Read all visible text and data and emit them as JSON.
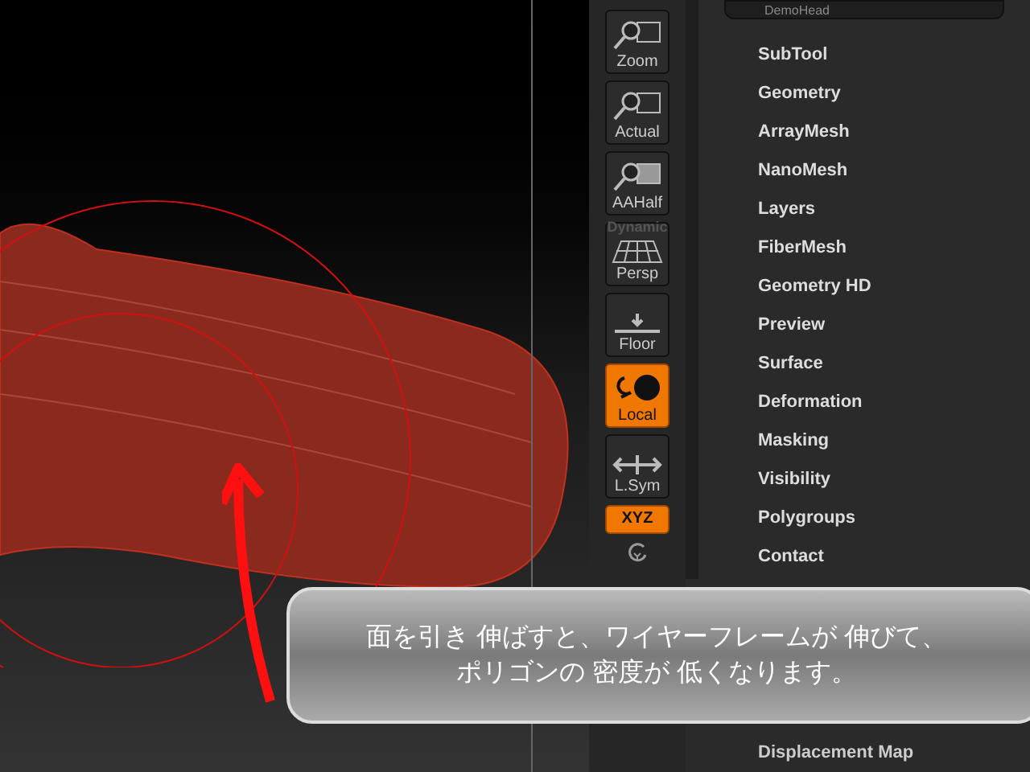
{
  "subtool_preview": {
    "label": "DemoHead"
  },
  "shelf": [
    {
      "kind": "button",
      "label": "Zoom",
      "on": false
    },
    {
      "kind": "button",
      "label": "Actual",
      "on": false
    },
    {
      "kind": "button",
      "label": "AAHalf",
      "on": false
    },
    {
      "kind": "button",
      "label": "Persp",
      "top_label": "Dynamic",
      "on": false
    },
    {
      "kind": "button",
      "label": "Floor",
      "on": false
    },
    {
      "kind": "button",
      "label": "Local",
      "on": true
    },
    {
      "kind": "button",
      "label": "L.Sym",
      "on": false
    },
    {
      "kind": "small",
      "label": "XYZ",
      "on": true
    },
    {
      "kind": "icon"
    }
  ],
  "menu": [
    "SubTool",
    "Geometry",
    "ArrayMesh",
    "NanoMesh",
    "Layers",
    "FiberMesh",
    "Geometry HD",
    "Preview",
    "Surface",
    "Deformation",
    "Masking",
    "Visibility",
    "Polygroups",
    "Contact"
  ],
  "menu_bottom": "Displacement Map",
  "caption": [
    "面を引き 伸ばすと、ワイヤーフレームが 伸びて、",
    "ポリゴンの 密度が 低くなります。"
  ]
}
